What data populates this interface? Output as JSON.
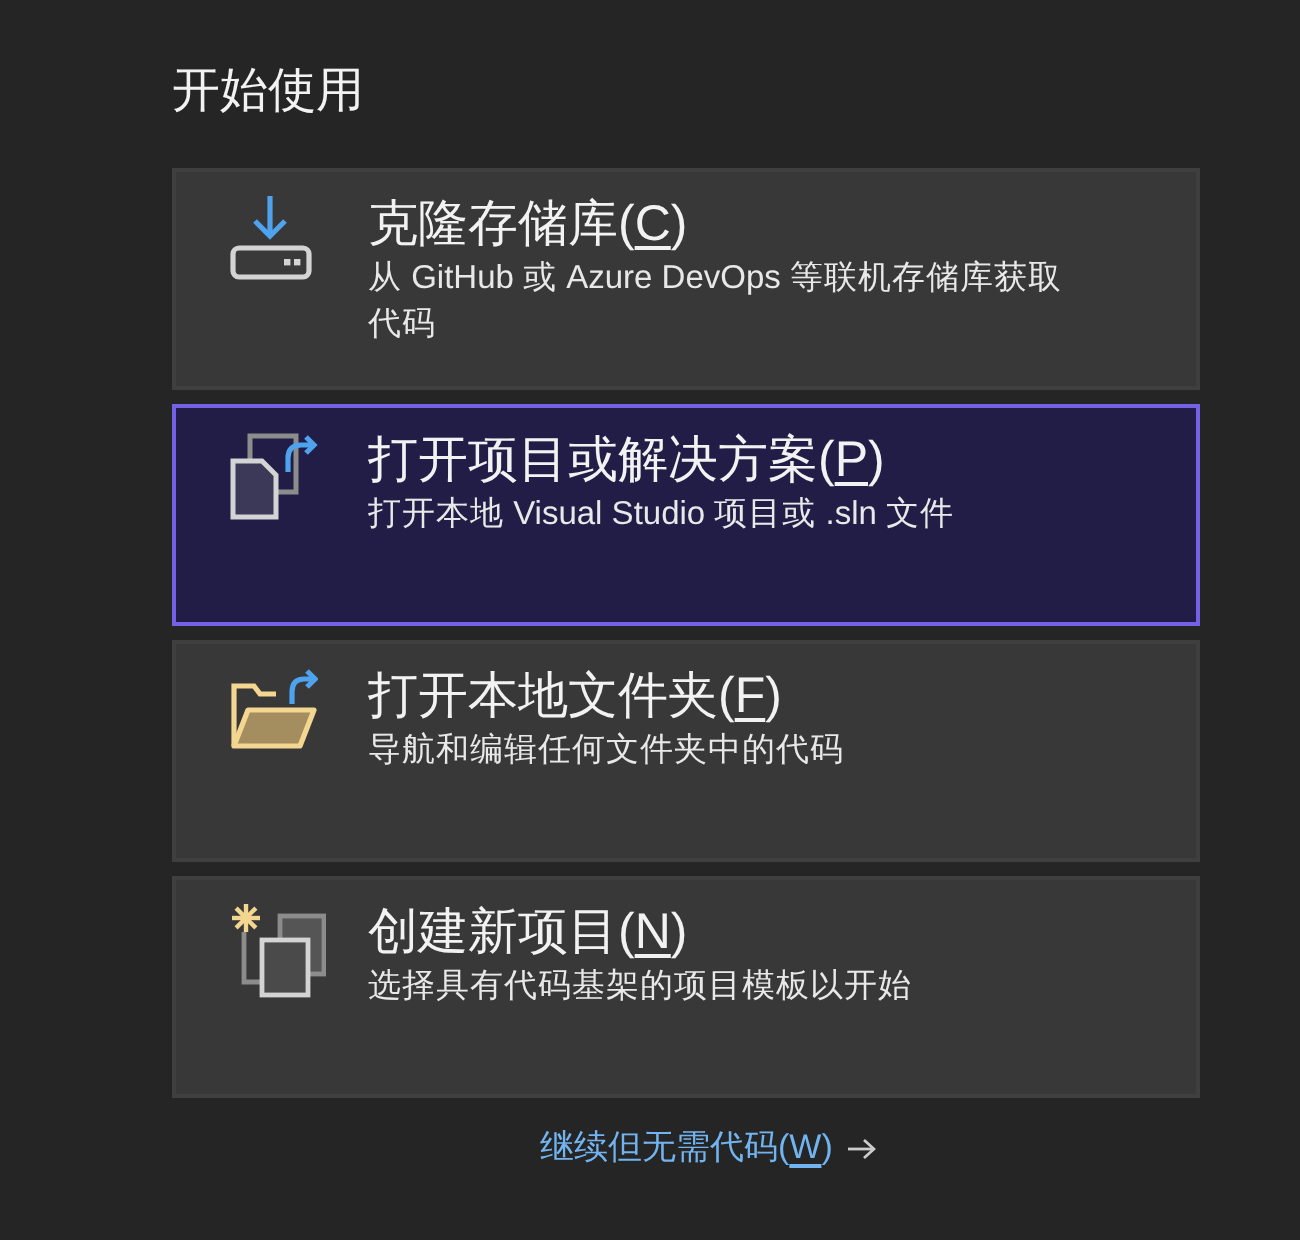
{
  "heading": "开始使用",
  "cards": [
    {
      "title_parts": [
        {
          "text": "克隆存储库(",
          "underline": false
        },
        {
          "text": "C",
          "underline": true
        },
        {
          "text": ")",
          "underline": false
        }
      ],
      "description": "从 GitHub 或 Azure DevOps 等联机存储库获取代码",
      "selected": false
    },
    {
      "title_parts": [
        {
          "text": "打开项目或解决方案(",
          "underline": false
        },
        {
          "text": "P",
          "underline": true
        },
        {
          "text": ")",
          "underline": false
        }
      ],
      "description": "打开本地 Visual Studio 项目或 .sln 文件",
      "selected": true
    },
    {
      "title_parts": [
        {
          "text": "打开本地文件夹(",
          "underline": false
        },
        {
          "text": "F",
          "underline": true
        },
        {
          "text": ")",
          "underline": false
        }
      ],
      "description": "导航和编辑任何文件夹中的代码",
      "selected": false
    },
    {
      "title_parts": [
        {
          "text": "创建新项目(",
          "underline": false
        },
        {
          "text": "N",
          "underline": true
        },
        {
          "text": ")",
          "underline": false
        }
      ],
      "description": "选择具有代码基架的项目模板以开始",
      "selected": false
    }
  ],
  "link": {
    "parts": [
      {
        "text": "继续但无需代码(",
        "underline": false
      },
      {
        "text": "W",
        "underline": true
      },
      {
        "text": ")",
        "underline": false
      }
    ]
  }
}
